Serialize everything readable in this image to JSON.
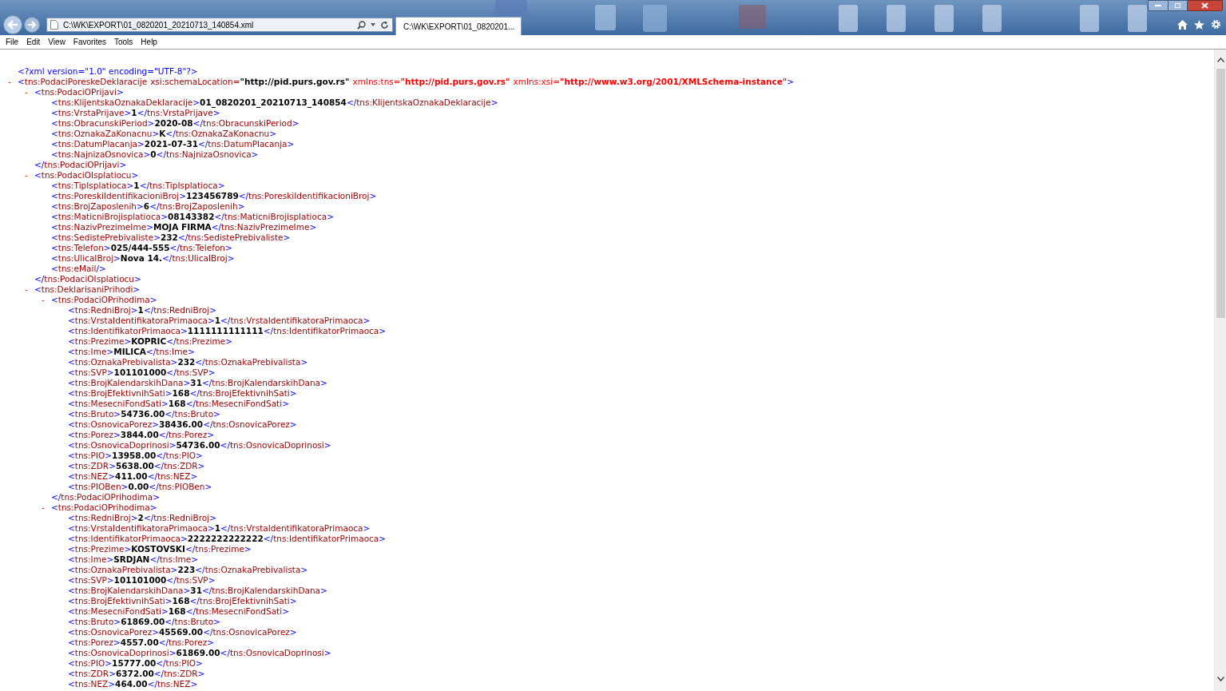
{
  "address_bar": {
    "value": "C:\\WK\\EXPORT\\01_0820201_20210713_140854.xml"
  },
  "tabs": [
    {
      "label": "C:\\WK\\EXPORT\\01_0820201...",
      "selected": true
    }
  ],
  "menu": [
    "File",
    "Edit",
    "View",
    "Favorites",
    "Tools",
    "Help"
  ],
  "document": {
    "declaration": "<?xml version=\"1.0\" encoding=\"UTF-8\"?>",
    "root": {
      "toggle": "-",
      "open": "<tns:PodaciPoreskeDeklaracije",
      "attributes": [
        {
          "name": "xsi:schemaLocation=",
          "value": "\"http://pid.purs.gov.rs\"",
          "kind": "attribute"
        },
        {
          "name": "xmlns:tns=",
          "value": "\"http://pid.purs.gov.rs\"",
          "kind": "namespace"
        },
        {
          "name": "xmlns:xsi=",
          "value": "\"http://www.w3.org/2001/XMLSchema-instance\"",
          "kind": "namespace"
        }
      ],
      "open_end": ">",
      "children": [
        {
          "toggle": "-",
          "open": "<tns:PodaciOPrijavi>",
          "close": "</tns:PodaciOPrijavi>",
          "children": [
            {
              "open": "<tns:KlijentskaOznakaDeklaracije>",
              "value": "01_0820201_20210713_140854",
              "close": "</tns:KlijentskaOznakaDeklaracije>"
            },
            {
              "open": "<tns:VrstaPrijave>",
              "value": "1",
              "close": "</tns:VrstaPrijave>"
            },
            {
              "open": "<tns:ObracunskiPeriod>",
              "value": "2020-08",
              "close": "</tns:ObracunskiPeriod>"
            },
            {
              "open": "<tns:OznakaZaKonacnu>",
              "value": "K",
              "close": "</tns:OznakaZaKonacnu>"
            },
            {
              "open": "<tns:DatumPlacanja>",
              "value": "2021-07-31",
              "close": "</tns:DatumPlacanja>"
            },
            {
              "open": "<tns:NajnizaOsnovica>",
              "value": "0",
              "close": "</tns:NajnizaOsnovica>"
            }
          ]
        },
        {
          "toggle": "-",
          "open": "<tns:PodaciOIsplatiocu>",
          "close": "</tns:PodaciOIsplatiocu>",
          "children": [
            {
              "open": "<tns:TipIsplatioca>",
              "value": "1",
              "close": "</tns:TipIsplatioca>"
            },
            {
              "open": "<tns:PoreskiIdentifikacioniBroj>",
              "value": "123456789",
              "close": "</tns:PoreskiIdentifikacioniBroj>"
            },
            {
              "open": "<tns:BrojZaposlenih>",
              "value": "6",
              "close": "</tns:BrojZaposlenih>"
            },
            {
              "open": "<tns:MaticniBrojisplatioca>",
              "value": "08143382",
              "close": "</tns:MaticniBrojisplatioca>"
            },
            {
              "open": "<tns:NazivPrezimeIme>",
              "value": "MOJA FIRMA",
              "close": "</tns:NazivPrezimeIme>"
            },
            {
              "open": "<tns:SedistePrebivaliste>",
              "value": "232",
              "close": "</tns:SedistePrebivaliste>"
            },
            {
              "open": "<tns:Telefon>",
              "value": "025/444-555",
              "close": "</tns:Telefon>"
            },
            {
              "open": "<tns:UlicaIBroj>",
              "value": "Nova 14.",
              "close": "</tns:UlicaIBroj>"
            },
            {
              "empty": "<tns:eMail/>"
            }
          ]
        },
        {
          "toggle": "-",
          "open": "<tns:DeklarisaniPrihodi>",
          "children": [
            {
              "toggle": "-",
              "open": "<tns:PodaciOPrihodima>",
              "close": "</tns:PodaciOPrihodima>",
              "children": [
                {
                  "open": "<tns:RedniBroj>",
                  "value": "1",
                  "close": "</tns:RedniBroj>"
                },
                {
                  "open": "<tns:VrstaIdentifikatoraPrimaoca>",
                  "value": "1",
                  "close": "</tns:VrstaIdentifikatoraPrimaoca>"
                },
                {
                  "open": "<tns:IdentifikatorPrimaoca>",
                  "value": "1111111111111",
                  "close": "</tns:IdentifikatorPrimaoca>"
                },
                {
                  "open": "<tns:Prezime>",
                  "value": "KOPRIC",
                  "close": "</tns:Prezime>"
                },
                {
                  "open": "<tns:Ime>",
                  "value": "MILICA",
                  "close": "</tns:Ime>"
                },
                {
                  "open": "<tns:OznakaPrebivalista>",
                  "value": "232",
                  "close": "</tns:OznakaPrebivalista>"
                },
                {
                  "open": "<tns:SVP>",
                  "value": "101101000",
                  "close": "</tns:SVP>"
                },
                {
                  "open": "<tns:BrojKalendarskihDana>",
                  "value": "31",
                  "close": "</tns:BrojKalendarskihDana>"
                },
                {
                  "open": "<tns:BrojEfektivnihSati>",
                  "value": "168",
                  "close": "</tns:BrojEfektivnihSati>"
                },
                {
                  "open": "<tns:MesecniFondSati>",
                  "value": "168",
                  "close": "</tns:MesecniFondSati>"
                },
                {
                  "open": "<tns:Bruto>",
                  "value": "54736.00",
                  "close": "</tns:Bruto>"
                },
                {
                  "open": "<tns:OsnovicaPorez>",
                  "value": "38436.00",
                  "close": "</tns:OsnovicaPorez>"
                },
                {
                  "open": "<tns:Porez>",
                  "value": "3844.00",
                  "close": "</tns:Porez>"
                },
                {
                  "open": "<tns:OsnovicaDoprinosi>",
                  "value": "54736.00",
                  "close": "</tns:OsnovicaDoprinosi>"
                },
                {
                  "open": "<tns:PIO>",
                  "value": "13958.00",
                  "close": "</tns:PIO>"
                },
                {
                  "open": "<tns:ZDR>",
                  "value": "5638.00",
                  "close": "</tns:ZDR>"
                },
                {
                  "open": "<tns:NEZ>",
                  "value": "411.00",
                  "close": "</tns:NEZ>"
                },
                {
                  "open": "<tns:PIOBen>",
                  "value": "0.00",
                  "close": "</tns:PIOBen>"
                }
              ]
            },
            {
              "toggle": "-",
              "open": "<tns:PodaciOPrihodima>",
              "children": [
                {
                  "open": "<tns:RedniBroj>",
                  "value": "2",
                  "close": "</tns:RedniBroj>"
                },
                {
                  "open": "<tns:VrstaIdentifikatoraPrimaoca>",
                  "value": "1",
                  "close": "</tns:VrstaIdentifikatoraPrimaoca>"
                },
                {
                  "open": "<tns:IdentifikatorPrimaoca>",
                  "value": "2222222222222",
                  "close": "</tns:IdentifikatorPrimaoca>"
                },
                {
                  "open": "<tns:Prezime>",
                  "value": "KOSTOVSKI",
                  "close": "</tns:Prezime>"
                },
                {
                  "open": "<tns:Ime>",
                  "value": "SRDJAN",
                  "close": "</tns:Ime>"
                },
                {
                  "open": "<tns:OznakaPrebivalista>",
                  "value": "223",
                  "close": "</tns:OznakaPrebivalista>"
                },
                {
                  "open": "<tns:SVP>",
                  "value": "101101000",
                  "close": "</tns:SVP>"
                },
                {
                  "open": "<tns:BrojKalendarskihDana>",
                  "value": "31",
                  "close": "</tns:BrojKalendarskihDana>"
                },
                {
                  "open": "<tns:BrojEfektivnihSati>",
                  "value": "168",
                  "close": "</tns:BrojEfektivnihSati>"
                },
                {
                  "open": "<tns:MesecniFondSati>",
                  "value": "168",
                  "close": "</tns:MesecniFondSati>"
                },
                {
                  "open": "<tns:Bruto>",
                  "value": "61869.00",
                  "close": "</tns:Bruto>"
                },
                {
                  "open": "<tns:OsnovicaPorez>",
                  "value": "45569.00",
                  "close": "</tns:OsnovicaPorez>"
                },
                {
                  "open": "<tns:Porez>",
                  "value": "4557.00",
                  "close": "</tns:Porez>"
                },
                {
                  "open": "<tns:OsnovicaDoprinosi>",
                  "value": "61869.00",
                  "close": "</tns:OsnovicaDoprinosi>"
                },
                {
                  "open": "<tns:PIO>",
                  "value": "15777.00",
                  "close": "</tns:PIO>"
                },
                {
                  "open": "<tns:ZDR>",
                  "value": "6372.00",
                  "close": "</tns:ZDR>"
                },
                {
                  "open": "<tns:NEZ>",
                  "value": "464.00",
                  "close": "</tns:NEZ>"
                }
              ]
            }
          ]
        }
      ]
    }
  }
}
